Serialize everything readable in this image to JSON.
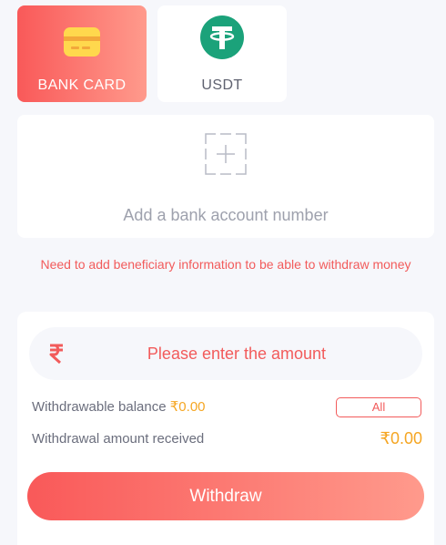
{
  "tabs": [
    {
      "label": "BANK CARD",
      "icon": "bank-card-icon",
      "selected": true
    },
    {
      "label": "USDT",
      "icon": "tether-icon",
      "selected": false
    }
  ],
  "add_account": {
    "text": "Add a bank account number",
    "icon": "add-icon"
  },
  "warning": "Need to add beneficiary information to be able to withdraw money",
  "amount": {
    "currency_symbol": "₹",
    "placeholder": "Please enter the amount"
  },
  "balance": {
    "label": "Withdrawable balance",
    "value": "₹0.00",
    "all_label": "All"
  },
  "received": {
    "label": "Withdrawal amount received",
    "value": "₹0.00"
  },
  "withdraw_label": "Withdraw",
  "colors": {
    "accent": "#f95959",
    "accent_light": "#ff9a8c",
    "value": "#f5a623",
    "tether": "#1ba27a",
    "card_yellow": "#ffd84d"
  }
}
